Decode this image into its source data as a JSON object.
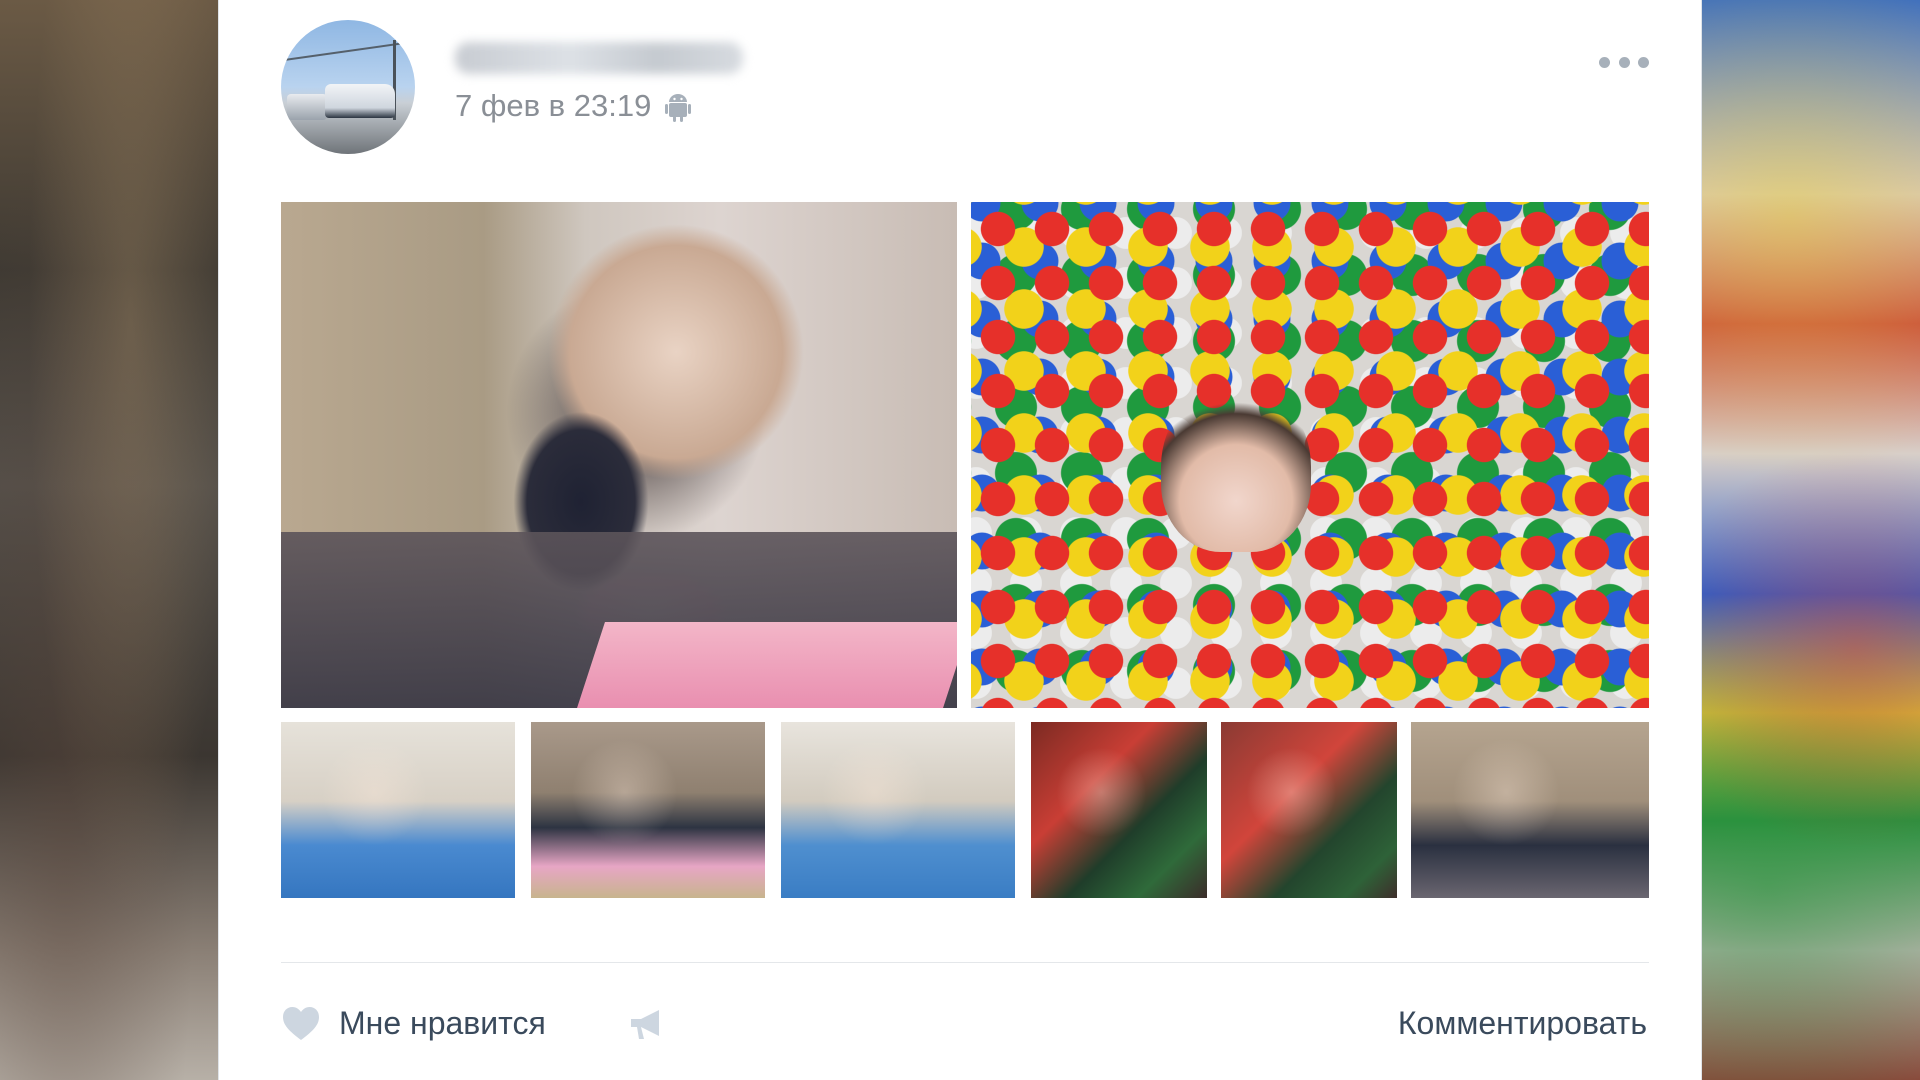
{
  "post": {
    "date": "7 фев в 23:19",
    "date_icon": "android-icon",
    "menu_icon": "more-icon",
    "actions": {
      "like_label": "Мне нравится",
      "like_icon": "heart-icon",
      "share_icon": "megaphone-icon",
      "comment_label": "Комментировать"
    }
  },
  "colors": {
    "card_bg": "#ffffff",
    "text_muted": "#8a8f96",
    "action_text": "#3a4a5c",
    "icon_gray": "#a7b0ba"
  }
}
